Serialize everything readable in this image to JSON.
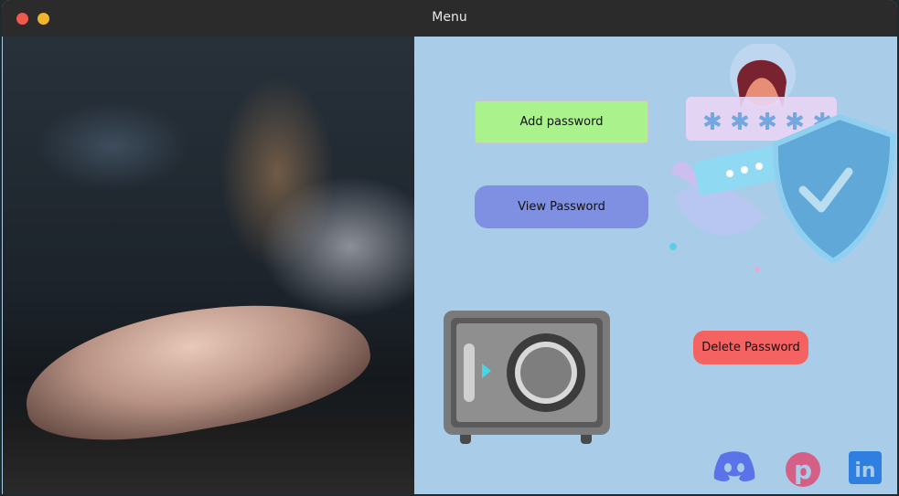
{
  "window": {
    "title": "Menu"
  },
  "buttons": {
    "add": "Add password",
    "view": "View Password",
    "delete": "Delete Password"
  },
  "icons": {
    "safe": "safe-icon",
    "illustration": "password-security-illustration",
    "discord": "discord-icon",
    "pinterest": "pinterest-icon",
    "linkedin": "linkedin-icon"
  },
  "colors": {
    "panel": "#a9cde8",
    "add": "#a9f28c",
    "view": "#7f90e2",
    "delete": "#f46262"
  }
}
